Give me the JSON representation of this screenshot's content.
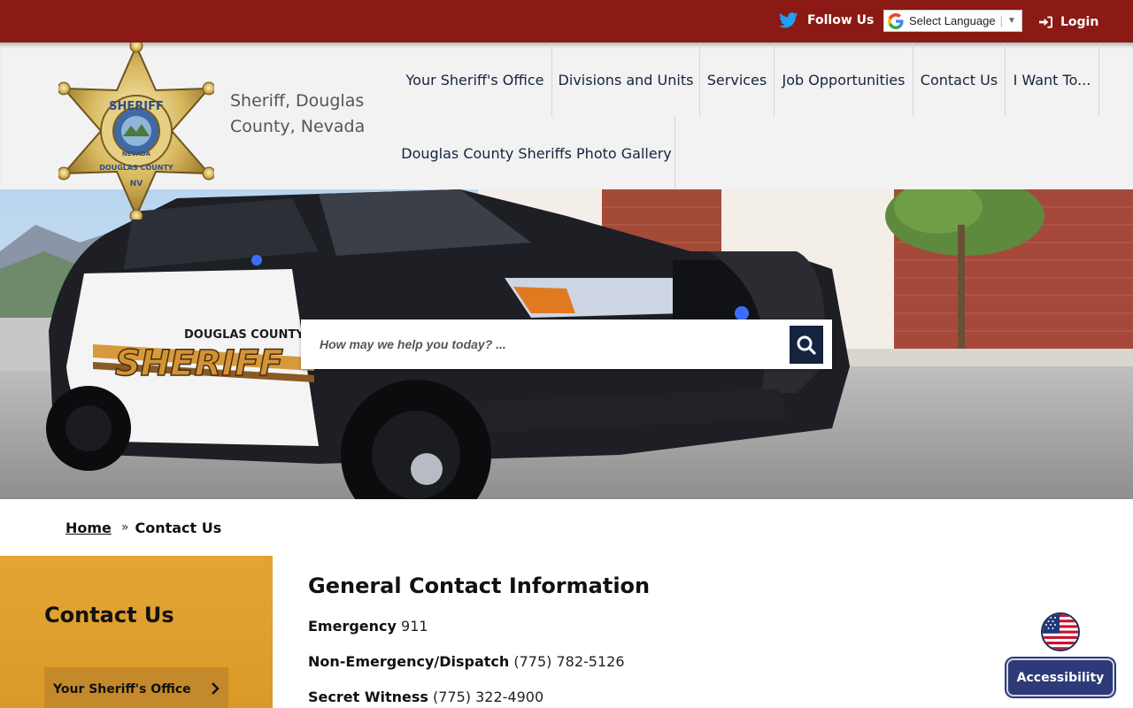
{
  "topbar": {
    "follow_label": "Follow Us",
    "translate_label": "Select Language",
    "login_label": "Login"
  },
  "header": {
    "site_name_line1": "Sheriff, Douglas",
    "site_name_line2": "County, Nevada",
    "badge_top_text": "SHERIFF",
    "badge_bottom_text": "DOUGLAS COUNTY",
    "badge_state": "NEVADA",
    "badge_nv": "NV"
  },
  "nav": {
    "items": [
      {
        "label": "Your Sheriff's Office"
      },
      {
        "label": "Divisions and Units"
      },
      {
        "label": "Services"
      },
      {
        "label": "Job Opportunities"
      },
      {
        "label": "Contact Us"
      },
      {
        "label": "I Want To..."
      },
      {
        "label": "Douglas County Sheriffs Photo Gallery"
      }
    ]
  },
  "hero": {
    "search_placeholder": "How may we help you today? ...",
    "vehicle_text_county": "DOUGLAS COUNTY",
    "vehicle_text_sheriff": "SHERIFF"
  },
  "breadcrumb": {
    "home": "Home",
    "separator": "»",
    "current": "Contact Us"
  },
  "sidebar": {
    "title": "Contact Us",
    "links": [
      {
        "label": "Your Sheriff's Office"
      }
    ]
  },
  "content": {
    "title": "General Contact Information",
    "contacts": [
      {
        "label": "Emergency",
        "value": "911"
      },
      {
        "label": "Non-Emergency/Dispatch",
        "value": "(775) 782-5126"
      },
      {
        "label": "Secret Witness",
        "value": "(775) 322-4900"
      }
    ]
  },
  "accessibility": {
    "label": "Accessibility"
  },
  "colors": {
    "topbar": "#8b1a14",
    "nav_text": "#15233f",
    "sidebar": "#e3a532",
    "accessibility": "#2d3a77"
  },
  "icons": [
    "twitter-icon",
    "google-translate-icon",
    "login-icon",
    "search-icon",
    "chevron-right-icon",
    "us-flag-icon"
  ]
}
